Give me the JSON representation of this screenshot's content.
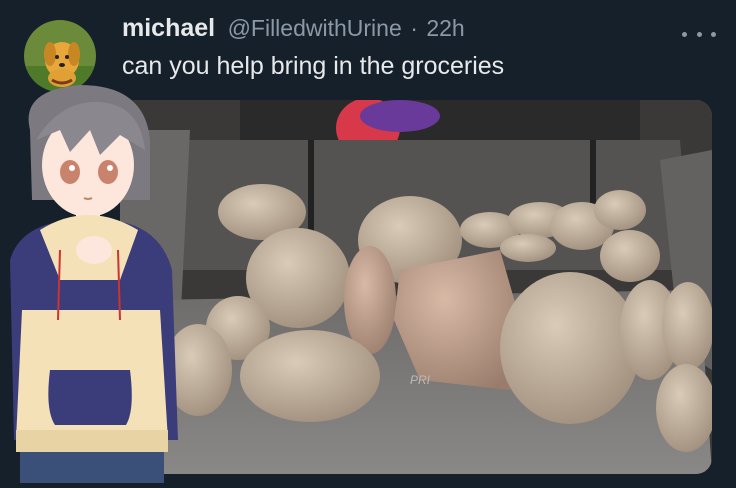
{
  "tweet": {
    "author": {
      "display_name": "michael",
      "handle": "@FilledwithUrine",
      "separator": "·",
      "time": "22h",
      "avatar_icon": "dog-avatar"
    },
    "text": "can you help bring in the groceries",
    "more_icon": "more-dots-icon",
    "media": {
      "content": "car-trunk-full-of-rocks",
      "overlay": "anime-girl-sticker",
      "trunk_badge_text": "PRI"
    }
  },
  "colors": {
    "background": "#15202b",
    "primary_text": "#e7e9ea",
    "secondary_text": "#8b98a5"
  }
}
